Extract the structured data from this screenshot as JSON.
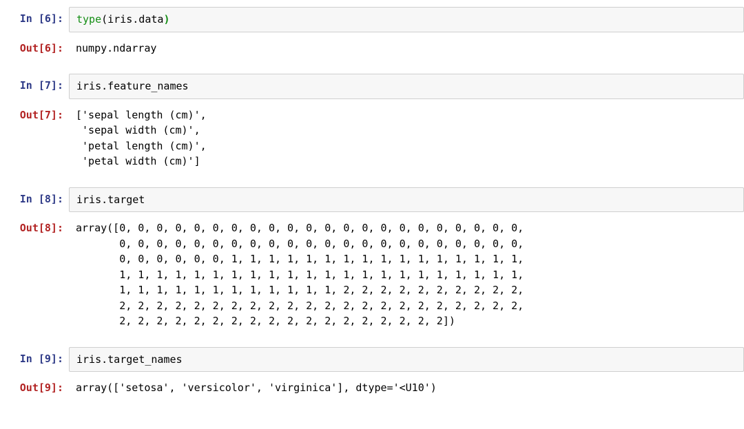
{
  "cells": [
    {
      "in_prompt": "In [6]:",
      "out_prompt": "Out[6]:",
      "input_plain": "type(iris.data)",
      "input_tokens": [
        {
          "t": "type",
          "cls": "tok-builtin"
        },
        {
          "t": "(",
          "cls": ""
        },
        {
          "t": "iris.data",
          "cls": ""
        },
        {
          "t": ")",
          "cls": "tok-paren-hl"
        }
      ],
      "output": "numpy.ndarray"
    },
    {
      "in_prompt": "In [7]:",
      "out_prompt": "Out[7]:",
      "input_plain": "iris.feature_names",
      "input_tokens": [
        {
          "t": "iris.feature_names",
          "cls": ""
        }
      ],
      "output": "['sepal length (cm)',\n 'sepal width (cm)',\n 'petal length (cm)',\n 'petal width (cm)']"
    },
    {
      "in_prompt": "In [8]:",
      "out_prompt": "Out[8]:",
      "input_plain": "iris.target",
      "input_tokens": [
        {
          "t": "iris.target",
          "cls": ""
        }
      ],
      "output": "array([0, 0, 0, 0, 0, 0, 0, 0, 0, 0, 0, 0, 0, 0, 0, 0, 0, 0, 0, 0, 0, 0,\n       0, 0, 0, 0, 0, 0, 0, 0, 0, 0, 0, 0, 0, 0, 0, 0, 0, 0, 0, 0, 0, 0,\n       0, 0, 0, 0, 0, 0, 1, 1, 1, 1, 1, 1, 1, 1, 1, 1, 1, 1, 1, 1, 1, 1,\n       1, 1, 1, 1, 1, 1, 1, 1, 1, 1, 1, 1, 1, 1, 1, 1, 1, 1, 1, 1, 1, 1,\n       1, 1, 1, 1, 1, 1, 1, 1, 1, 1, 1, 1, 2, 2, 2, 2, 2, 2, 2, 2, 2, 2,\n       2, 2, 2, 2, 2, 2, 2, 2, 2, 2, 2, 2, 2, 2, 2, 2, 2, 2, 2, 2, 2, 2,\n       2, 2, 2, 2, 2, 2, 2, 2, 2, 2, 2, 2, 2, 2, 2, 2, 2, 2])"
    },
    {
      "in_prompt": "In [9]:",
      "out_prompt": "Out[9]:",
      "input_plain": "iris.target_names",
      "input_tokens": [
        {
          "t": "iris.target_names",
          "cls": ""
        }
      ],
      "output": "array(['setosa', 'versicolor', 'virginica'], dtype='<U10')"
    }
  ]
}
